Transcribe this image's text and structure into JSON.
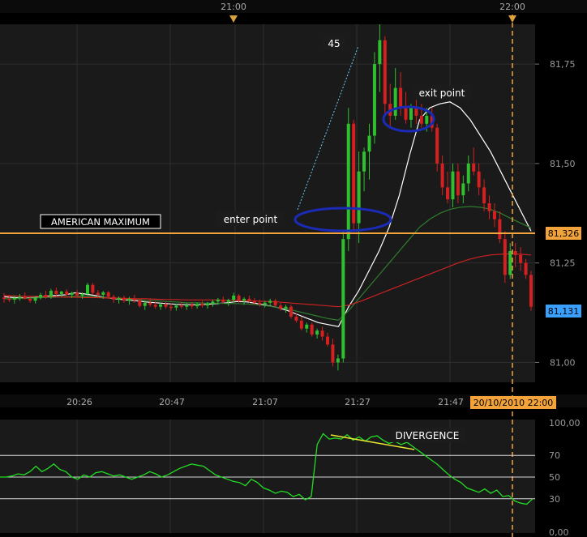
{
  "chart_data": [
    {
      "type": "candlestick",
      "ylim": [
        80.95,
        81.85
      ],
      "top_time_labels": [
        "21:00",
        "22:00"
      ],
      "x_tick_labels": [
        "20:26",
        "20:47",
        "21:07",
        "21:27",
        "21:47"
      ],
      "y_ticks": [
        81.0,
        81.25,
        81.5,
        81.75
      ],
      "y_tick_labels": [
        "81,00",
        "81,25",
        "81,50",
        "81,75"
      ],
      "price_tags": {
        "upper": {
          "value": 81.326,
          "label": "81,326"
        },
        "lower": {
          "value": 81.131,
          "label": "81,131"
        }
      },
      "date_label": "20/10/2010 22:00",
      "annotations": {
        "angle": "45",
        "exit": "exit point",
        "enter": "enter point",
        "level": "AMERICAN MAXIMUM"
      },
      "candles": [
        [
          81.163,
          81.174,
          81.15,
          81.16
        ],
        [
          81.16,
          81.17,
          81.152,
          81.158
        ],
        [
          81.158,
          81.168,
          81.148,
          81.162
        ],
        [
          81.162,
          81.172,
          81.155,
          81.165
        ],
        [
          81.165,
          81.176,
          81.158,
          81.16
        ],
        [
          81.16,
          81.168,
          81.15,
          81.155
        ],
        [
          81.155,
          81.166,
          81.148,
          81.163
        ],
        [
          81.163,
          81.175,
          81.158,
          81.17
        ],
        [
          81.17,
          81.18,
          81.16,
          81.165
        ],
        [
          81.165,
          81.185,
          81.16,
          81.18
        ],
        [
          81.18,
          81.188,
          81.168,
          81.172
        ],
        [
          81.172,
          81.18,
          81.165,
          81.178
        ],
        [
          81.178,
          81.184,
          81.168,
          81.17
        ],
        [
          81.17,
          81.178,
          81.162,
          81.175
        ],
        [
          81.175,
          81.182,
          81.166,
          81.168
        ],
        [
          81.168,
          81.176,
          81.16,
          81.172
        ],
        [
          81.172,
          81.2,
          81.168,
          81.195
        ],
        [
          81.195,
          81.2,
          81.17,
          81.175
        ],
        [
          81.175,
          81.182,
          81.164,
          81.17
        ],
        [
          81.17,
          81.18,
          81.16,
          81.176
        ],
        [
          81.176,
          81.18,
          81.16,
          81.165
        ],
        [
          81.165,
          81.17,
          81.15,
          81.158
        ],
        [
          81.158,
          81.166,
          81.148,
          81.162
        ],
        [
          81.162,
          81.168,
          81.15,
          81.155
        ],
        [
          81.155,
          81.165,
          81.145,
          81.16
        ],
        [
          81.16,
          81.17,
          81.15,
          81.156
        ],
        [
          81.156,
          81.16,
          81.138,
          81.142
        ],
        [
          81.142,
          81.155,
          81.132,
          81.15
        ],
        [
          81.15,
          81.158,
          81.14,
          81.145
        ],
        [
          81.145,
          81.155,
          81.135,
          81.14
        ],
        [
          81.14,
          81.15,
          81.132,
          81.146
        ],
        [
          81.146,
          81.152,
          81.135,
          81.14
        ],
        [
          81.14,
          81.148,
          81.13,
          81.138
        ],
        [
          81.138,
          81.148,
          81.13,
          81.143
        ],
        [
          81.143,
          81.152,
          81.135,
          81.14
        ],
        [
          81.14,
          81.15,
          81.132,
          81.145
        ],
        [
          81.145,
          81.152,
          81.135,
          81.141
        ],
        [
          81.141,
          81.15,
          81.135,
          81.147
        ],
        [
          81.147,
          81.155,
          81.138,
          81.143
        ],
        [
          81.143,
          81.152,
          81.135,
          81.148
        ],
        [
          81.148,
          81.158,
          81.14,
          81.153
        ],
        [
          81.153,
          81.162,
          81.145,
          81.158
        ],
        [
          81.158,
          81.165,
          81.148,
          81.152
        ],
        [
          81.152,
          81.16,
          81.142,
          81.157
        ],
        [
          81.157,
          81.175,
          81.15,
          81.168
        ],
        [
          81.168,
          81.172,
          81.15,
          81.155
        ],
        [
          81.155,
          81.164,
          81.145,
          81.16
        ],
        [
          81.16,
          81.168,
          81.15,
          81.155
        ],
        [
          81.155,
          81.162,
          81.145,
          81.15
        ],
        [
          81.15,
          81.158,
          81.14,
          81.146
        ],
        [
          81.146,
          81.155,
          81.138,
          81.15
        ],
        [
          81.15,
          81.16,
          81.142,
          81.155
        ],
        [
          81.155,
          81.16,
          81.14,
          81.143
        ],
        [
          81.143,
          81.15,
          81.13,
          81.135
        ],
        [
          81.135,
          81.145,
          81.125,
          81.14
        ],
        [
          81.14,
          81.145,
          81.11,
          81.115
        ],
        [
          81.115,
          81.125,
          81.1,
          81.105
        ],
        [
          81.105,
          81.115,
          81.08,
          81.085
        ],
        [
          81.085,
          81.1,
          81.075,
          81.095
        ],
        [
          81.095,
          81.1,
          81.065,
          81.07
        ],
        [
          81.07,
          81.085,
          81.06,
          81.08
        ],
        [
          81.08,
          81.09,
          81.055,
          81.065
        ],
        [
          81.065,
          81.075,
          81.04,
          81.045
        ],
        [
          81.045,
          81.06,
          80.99,
          81.0
        ],
        [
          81.0,
          81.02,
          80.98,
          81.01
        ],
        [
          81.01,
          81.33,
          81.0,
          81.31
        ],
        [
          81.31,
          81.64,
          81.28,
          81.6
        ],
        [
          81.6,
          81.61,
          81.33,
          81.35
        ],
        [
          81.35,
          81.53,
          81.3,
          81.48
        ],
        [
          81.48,
          81.54,
          81.43,
          81.53
        ],
        [
          81.53,
          81.6,
          81.46,
          81.57
        ],
        [
          81.57,
          81.78,
          81.55,
          81.75
        ],
        [
          81.75,
          81.85,
          81.68,
          81.81
        ],
        [
          81.81,
          81.82,
          81.62,
          81.65
        ],
        [
          81.65,
          81.7,
          81.59,
          81.62
        ],
        [
          81.62,
          81.74,
          81.61,
          81.69
        ],
        [
          81.69,
          81.73,
          81.62,
          81.64
        ],
        [
          81.64,
          81.68,
          81.6,
          81.61
        ],
        [
          81.61,
          81.65,
          81.59,
          81.64
        ],
        [
          81.64,
          81.66,
          81.6,
          81.62
        ],
        [
          81.62,
          81.65,
          81.59,
          81.6
        ],
        [
          81.6,
          81.64,
          81.58,
          81.62
        ],
        [
          81.62,
          81.64,
          81.58,
          81.59
        ],
        [
          81.59,
          81.6,
          81.48,
          81.5
        ],
        [
          81.5,
          81.52,
          81.42,
          81.44
        ],
        [
          81.44,
          81.48,
          81.4,
          81.41
        ],
        [
          81.41,
          81.5,
          81.39,
          81.48
        ],
        [
          81.48,
          81.5,
          81.4,
          81.42
        ],
        [
          81.42,
          81.47,
          81.4,
          81.45
        ],
        [
          81.45,
          81.52,
          81.43,
          81.5
        ],
        [
          81.5,
          81.54,
          81.47,
          81.48
        ],
        [
          81.48,
          81.5,
          81.42,
          81.44
        ],
        [
          81.44,
          81.46,
          81.38,
          81.4
        ],
        [
          81.4,
          81.42,
          81.36,
          81.38
        ],
        [
          81.38,
          81.4,
          81.34,
          81.36
        ],
        [
          81.36,
          81.38,
          81.3,
          81.31
        ],
        [
          81.31,
          81.33,
          81.2,
          81.22
        ],
        [
          81.22,
          81.3,
          81.21,
          81.28
        ],
        [
          81.28,
          81.3,
          81.24,
          81.27
        ],
        [
          81.27,
          81.29,
          81.23,
          81.25
        ],
        [
          81.25,
          81.26,
          81.21,
          81.22
        ],
        [
          81.22,
          81.23,
          81.13,
          81.14
        ]
      ],
      "overlay_series": [
        {
          "color": "#ffffff",
          "values": [
            81.165,
            81.163,
            81.162,
            81.163,
            81.166,
            81.168,
            81.17,
            81.175,
            81.172,
            81.168,
            81.163,
            81.16,
            81.157,
            81.155,
            81.152,
            81.15,
            81.148,
            81.146,
            81.145,
            81.145,
            81.146,
            81.148,
            81.15,
            81.153,
            81.152,
            81.148,
            81.143,
            81.138,
            81.13,
            81.12,
            81.11,
            81.1,
            81.095,
            81.09,
            81.14,
            81.18,
            81.23,
            81.28,
            81.34,
            81.42,
            81.52,
            81.61,
            81.64,
            81.65,
            81.655,
            81.64,
            81.61,
            81.57,
            81.53,
            81.48,
            81.43,
            81.38,
            81.33
          ]
        },
        {
          "color": "#2e7d2e",
          "values": [
            81.16,
            81.16,
            81.161,
            81.162,
            81.163,
            81.164,
            81.165,
            81.166,
            81.166,
            81.165,
            81.163,
            81.161,
            81.16,
            81.158,
            81.156,
            81.155,
            81.153,
            81.152,
            81.15,
            81.15,
            81.149,
            81.149,
            81.148,
            81.148,
            81.147,
            81.145,
            81.142,
            81.138,
            81.134,
            81.128,
            81.122,
            81.116,
            81.11,
            81.106,
            81.13,
            81.16,
            81.19,
            81.22,
            81.25,
            81.28,
            81.31,
            81.34,
            81.36,
            81.375,
            81.385,
            81.39,
            81.392,
            81.39,
            81.385,
            81.375,
            81.362,
            81.35,
            81.338
          ]
        },
        {
          "color": "#cc2222",
          "values": [
            81.168,
            81.167,
            81.166,
            81.166,
            81.165,
            81.165,
            81.164,
            81.164,
            81.163,
            81.163,
            81.162,
            81.162,
            81.161,
            81.16,
            81.16,
            81.159,
            81.158,
            81.158,
            81.157,
            81.157,
            81.157,
            81.157,
            81.156,
            81.156,
            81.155,
            81.154,
            81.153,
            81.152,
            81.15,
            81.148,
            81.146,
            81.144,
            81.142,
            81.14,
            81.144,
            81.152,
            81.162,
            81.172,
            81.182,
            81.192,
            81.202,
            81.212,
            81.222,
            81.232,
            81.242,
            81.252,
            81.26,
            81.266,
            81.27,
            81.272,
            81.273,
            81.272,
            81.27
          ]
        }
      ]
    },
    {
      "type": "line",
      "title": "",
      "ylim": [
        0,
        100
      ],
      "y_ticks": [
        30,
        50,
        70,
        100
      ],
      "y_tick_labels": [
        "30",
        "50",
        "70",
        "100,00"
      ],
      "bottom_label": "0,00",
      "annotation": "DIVERGENCE",
      "series": [
        {
          "color": "#22dd22",
          "values": [
            50,
            50,
            51,
            53,
            52,
            55,
            60,
            55,
            58,
            62,
            57,
            55,
            50,
            48,
            52,
            50,
            54,
            55,
            53,
            51,
            52,
            50,
            48,
            50,
            52,
            55,
            53,
            50,
            52,
            55,
            58,
            60,
            62,
            61,
            60,
            56,
            52,
            50,
            48,
            46,
            45,
            42,
            48,
            45,
            40,
            38,
            35,
            37,
            36,
            32,
            34,
            29,
            32,
            80,
            90,
            85,
            86,
            85,
            89,
            84,
            87,
            83,
            87,
            88,
            84,
            81,
            83,
            80,
            82,
            78,
            74,
            70,
            66,
            62,
            57,
            52,
            48,
            45,
            40,
            38,
            36,
            39,
            35,
            38,
            32,
            33,
            28,
            26,
            25,
            30
          ]
        }
      ]
    }
  ]
}
